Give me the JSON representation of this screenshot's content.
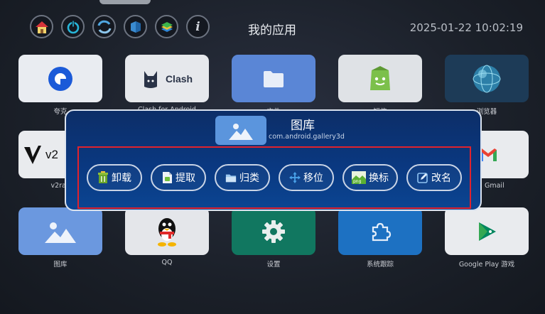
{
  "header": {
    "title": "我的应用",
    "datetime": "2025-01-22 10:02:19",
    "icons": [
      "home-icon",
      "power-icon",
      "refresh-icon",
      "cube-icon",
      "layers-icon",
      "info-icon"
    ],
    "info_glyph": "i"
  },
  "apps": [
    {
      "label": "夸克",
      "icon": "quark-icon"
    },
    {
      "label": "Clash for Android",
      "tile_text": "Clash",
      "icon": "clash-cat-icon"
    },
    {
      "label": "文件",
      "icon": "folder-icon"
    },
    {
      "label": "短信",
      "icon": "android-bag-icon"
    },
    {
      "label": "浏览器",
      "icon": "globe-icon"
    },
    {
      "label": "v2ray",
      "tile_text": "v2",
      "icon": "v2ray-icon"
    },
    {
      "label": "Gmail",
      "icon": "gmail-icon"
    },
    {
      "label": "图库",
      "icon": "gallery-icon"
    },
    {
      "label": "QQ",
      "icon": "qq-penguin-icon"
    },
    {
      "label": "设置",
      "icon": "gear-icon"
    },
    {
      "label": "系统跟踪",
      "icon": "puzzle-icon"
    },
    {
      "label": "Google Play 游戏",
      "icon": "play-games-icon"
    }
  ],
  "dialog": {
    "app_name": "图库",
    "package": "com.android.gallery3d",
    "actions": [
      {
        "label": "卸载",
        "icon": "trash-icon"
      },
      {
        "label": "提取",
        "icon": "apk-file-icon"
      },
      {
        "label": "归类",
        "icon": "folder-icon"
      },
      {
        "label": "移位",
        "icon": "move-arrows-icon"
      },
      {
        "label": "换标",
        "icon": "png-image-icon"
      },
      {
        "label": "改名",
        "icon": "edit-icon"
      }
    ],
    "png_badge": "png"
  },
  "colors": {
    "dialog_bg": "#0a3880",
    "highlight": "#e0222d",
    "accent_blue": "#5b95dd"
  }
}
